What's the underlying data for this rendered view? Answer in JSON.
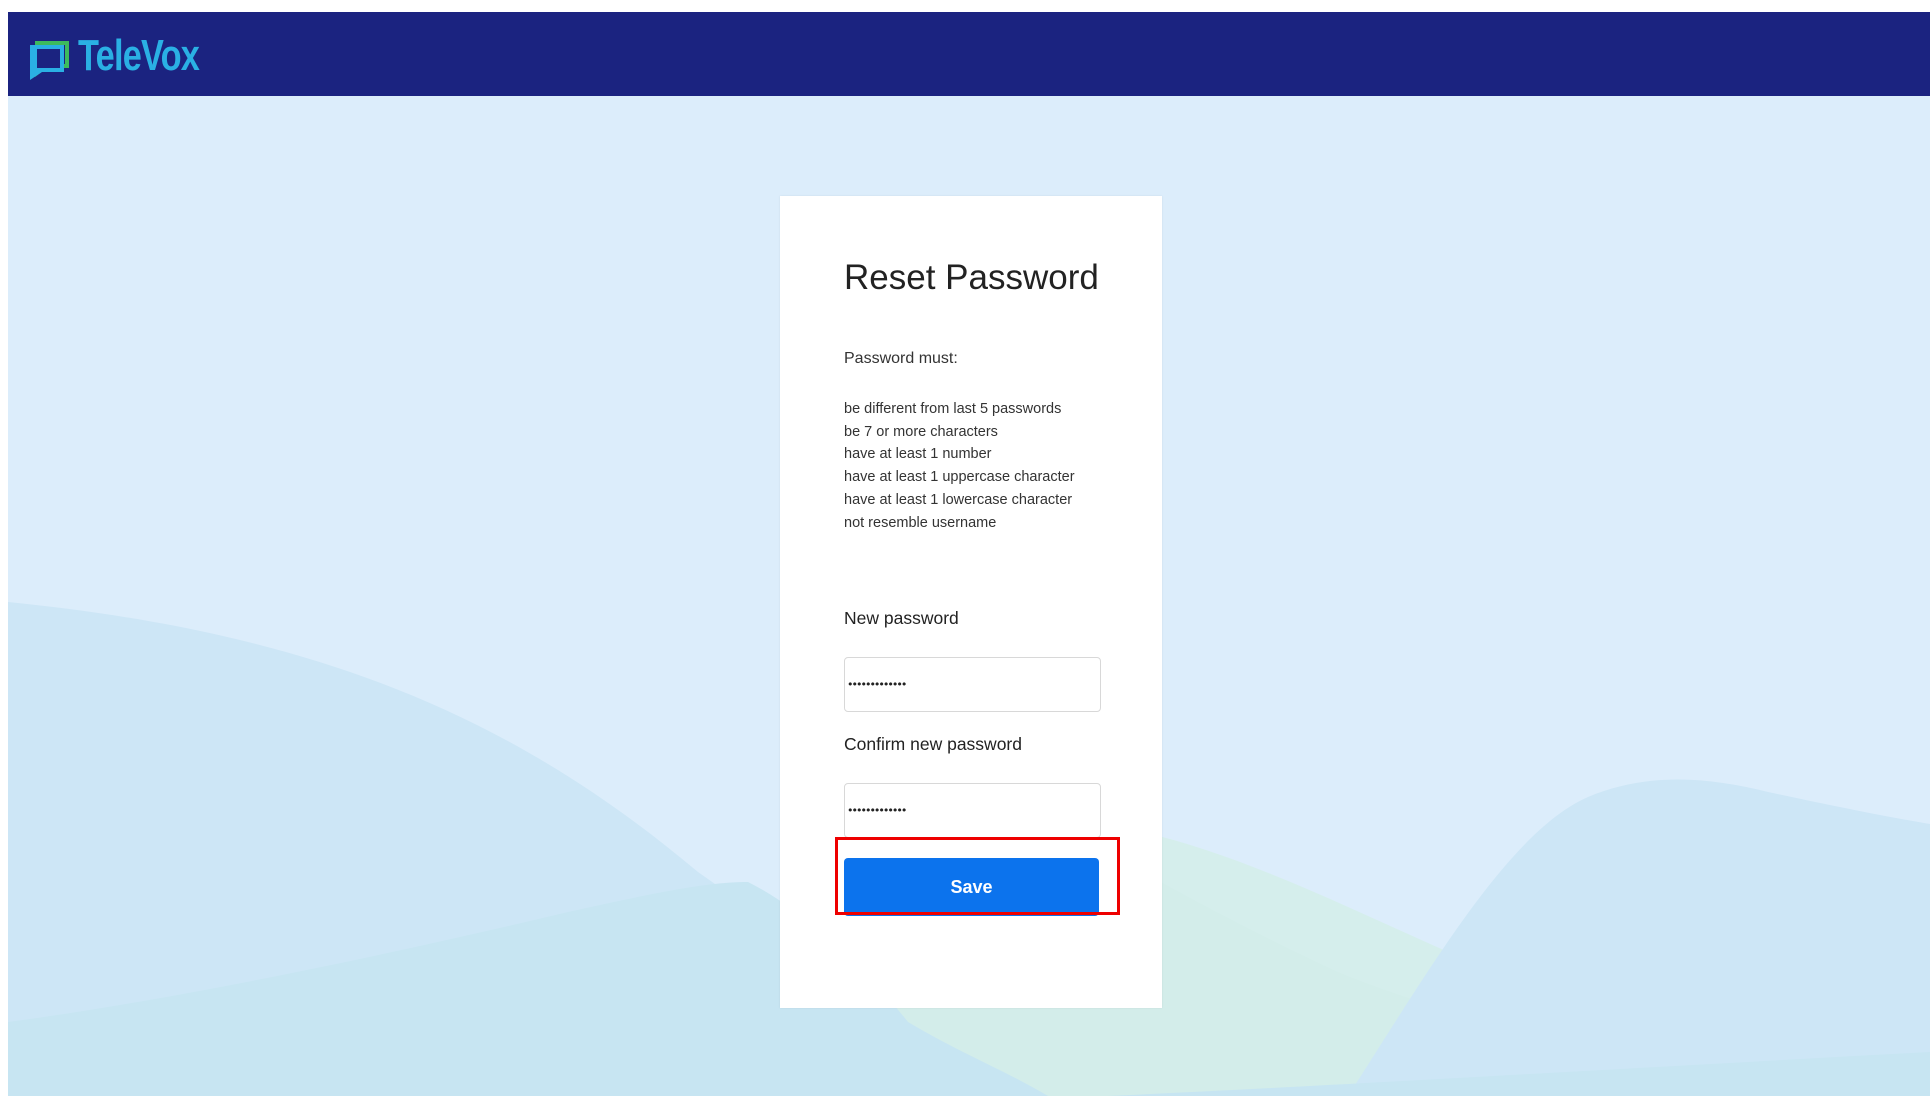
{
  "brand": {
    "name": "TeleVox",
    "logo_icon": "televox-logo-icon",
    "header_color": "#1b2380",
    "accent_color": "#2ab0e4"
  },
  "reset_form": {
    "title": "Reset Password",
    "requirements_intro": "Password must:",
    "requirements": [
      "be different from last 5 passwords",
      "be 7 or more characters",
      "have at least 1 number",
      "have at least 1 uppercase character",
      "have at least 1 lowercase character",
      "not resemble username"
    ],
    "new_password_label": "New password",
    "new_password_value": "•••••••••••••",
    "confirm_password_label": "Confirm new password",
    "confirm_password_value": "•••••••••••••",
    "save_label": "Save",
    "button_color": "#0c73ed",
    "highlight_color": "#ee0000"
  }
}
